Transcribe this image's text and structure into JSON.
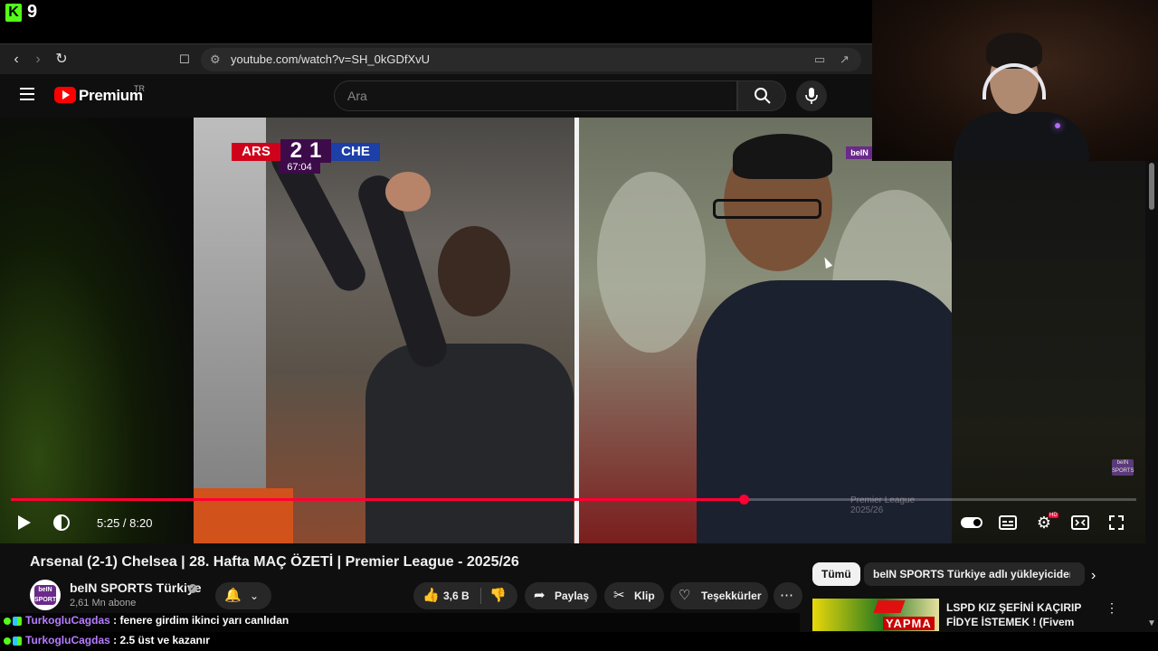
{
  "stream": {
    "platform_icon": "kick-logo-icon",
    "logo_letter": "K",
    "viewer_count": "9"
  },
  "browser": {
    "url": "youtube.com/watch?v=SH_0kGDfXvU"
  },
  "youtube": {
    "brand": "Premium",
    "region": "TR",
    "search_placeholder": "Ara"
  },
  "video": {
    "scoreboard": {
      "home": "ARS",
      "score": "2-1",
      "home_score": "2",
      "away_score": "1",
      "away": "CHE",
      "clock": "67:04"
    },
    "broadcaster_watermark": "beIN",
    "league_watermark": "Premier League",
    "league_watermark_season": "2025/26",
    "current_time": "5:25",
    "duration": "8:20",
    "time_display": "5:25 / 8:20",
    "progress_fraction": 0.651,
    "hd_badge": "HD"
  },
  "details": {
    "title": "Arsenal (2-1) Chelsea | 28. Hafta MAÇ ÖZETİ | Premier League - 2025/26",
    "channel_name": "beIN SPORTS Türkiye",
    "channel_avatar_text": "beIN SPORTS",
    "subscribers": "2,61 Mn abone",
    "likes": "3,6 B",
    "share_label": "Paylaş",
    "clip_label": "Klip",
    "thanks_label": "Teşekkürler"
  },
  "sidebar": {
    "chips": [
      "Tümü",
      "beIN SPORTS Türkiye adlı yükleyiciden"
    ],
    "recommendation": {
      "thumb_word": "YAPMA",
      "title": "LSPD KIZ ŞEFİNİ KAÇIRIP FİDYE İSTEMEK ! (Fivem Troll)"
    }
  },
  "chat": [
    {
      "user": "TurkogluCagdas",
      "message": ": fenere girdim ikinci yarı canlıdan"
    },
    {
      "user": "TurkogluCagdas",
      "message": ": 2.5 üst ve kazanır"
    }
  ],
  "colors": {
    "kick_green": "#53fc18",
    "youtube_red": "#ff0000",
    "progress_red": "#ff0033",
    "arsenal_red": "#d0021b",
    "chelsea_blue": "#1c3fa8",
    "pl_purple": "#3d0b4a",
    "chat_username": "#b67cff"
  }
}
